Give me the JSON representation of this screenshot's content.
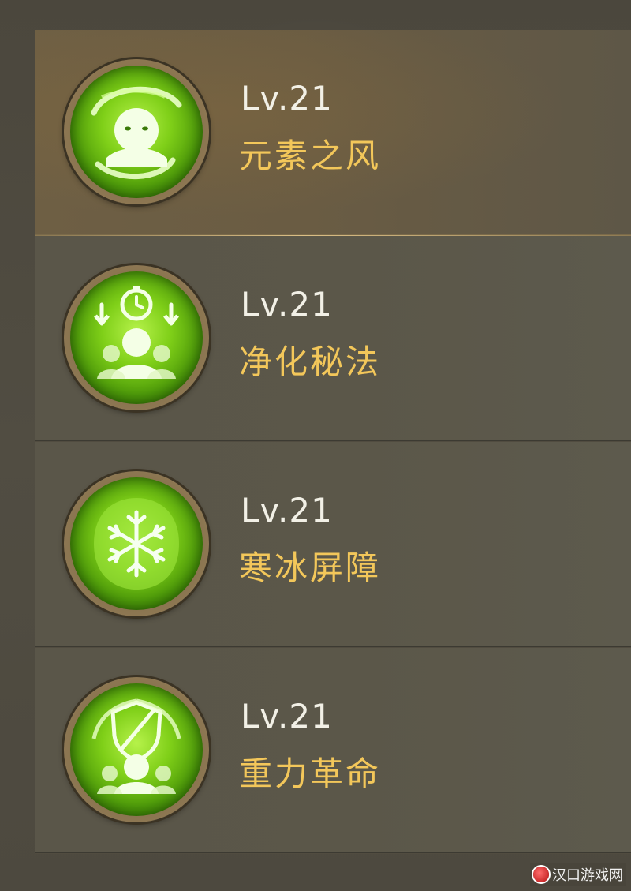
{
  "skills": [
    {
      "level": "Lv.21",
      "name": "元素之风",
      "icon": "wind-spirit-icon",
      "selected": true
    },
    {
      "level": "Lv.21",
      "name": "净化秘法",
      "icon": "purify-clock-icon",
      "selected": false
    },
    {
      "level": "Lv.21",
      "name": "寒冰屏障",
      "icon": "snowflake-shield-icon",
      "selected": false
    },
    {
      "level": "Lv.21",
      "name": "重力革命",
      "icon": "gravity-shield-icon",
      "selected": false
    }
  ],
  "watermark": {
    "text": "汉口游戏网"
  },
  "colors": {
    "level_text": "#f2f0e6",
    "name_text": "#f3c75a",
    "icon_green": "#7fcf18"
  }
}
